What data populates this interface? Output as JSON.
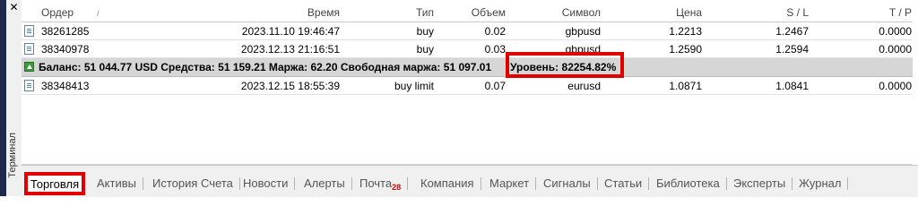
{
  "side": {
    "close_icon": "✕",
    "title": "Терминал"
  },
  "columns": {
    "order": "Ордер",
    "time": "Время",
    "type": "Тип",
    "volume": "Объем",
    "symbol": "Символ",
    "price": "Цена",
    "sl": "S / L",
    "tp": "T / P"
  },
  "orders": [
    {
      "order": "38261285",
      "time": "2023.11.10 19:46:47",
      "type": "buy",
      "volume": "0.02",
      "symbol": "gbpusd",
      "price": "1.2213",
      "sl": "1.2467",
      "tp": "0.0000"
    },
    {
      "order": "38340978",
      "time": "2023.12.13 21:16:51",
      "type": "buy",
      "volume": "0.03",
      "symbol": "gbpusd",
      "price": "1.2590",
      "sl": "1.2594",
      "tp": "0.0000"
    }
  ],
  "balance_line": "Баланс: 51 044.77 USD  Средства: 51 159.21  Маржа: 62.20  Свободная маржа: 51 097.01",
  "level_line": "Уровень: 82254.82%",
  "pending": [
    {
      "order": "38348413",
      "time": "2023.12.15 18:55:39",
      "type": "buy limit",
      "volume": "0.07",
      "symbol": "eurusd",
      "price": "1.0871",
      "sl": "1.0841",
      "tp": "0.0000"
    }
  ],
  "tabs": [
    {
      "label": "Торговля",
      "active": true
    },
    {
      "label": "Активы"
    },
    {
      "label": "История Счета"
    },
    {
      "label": "Новости"
    },
    {
      "label": "Алерты"
    },
    {
      "label": "Почта",
      "badge": "28"
    },
    {
      "label": "Компания"
    },
    {
      "label": "Маркет"
    },
    {
      "label": "Сигналы"
    },
    {
      "label": "Статьи"
    },
    {
      "label": "Библиотека"
    },
    {
      "label": "Эксперты"
    },
    {
      "label": "Журнал"
    }
  ],
  "highlight_color": "#e00000"
}
